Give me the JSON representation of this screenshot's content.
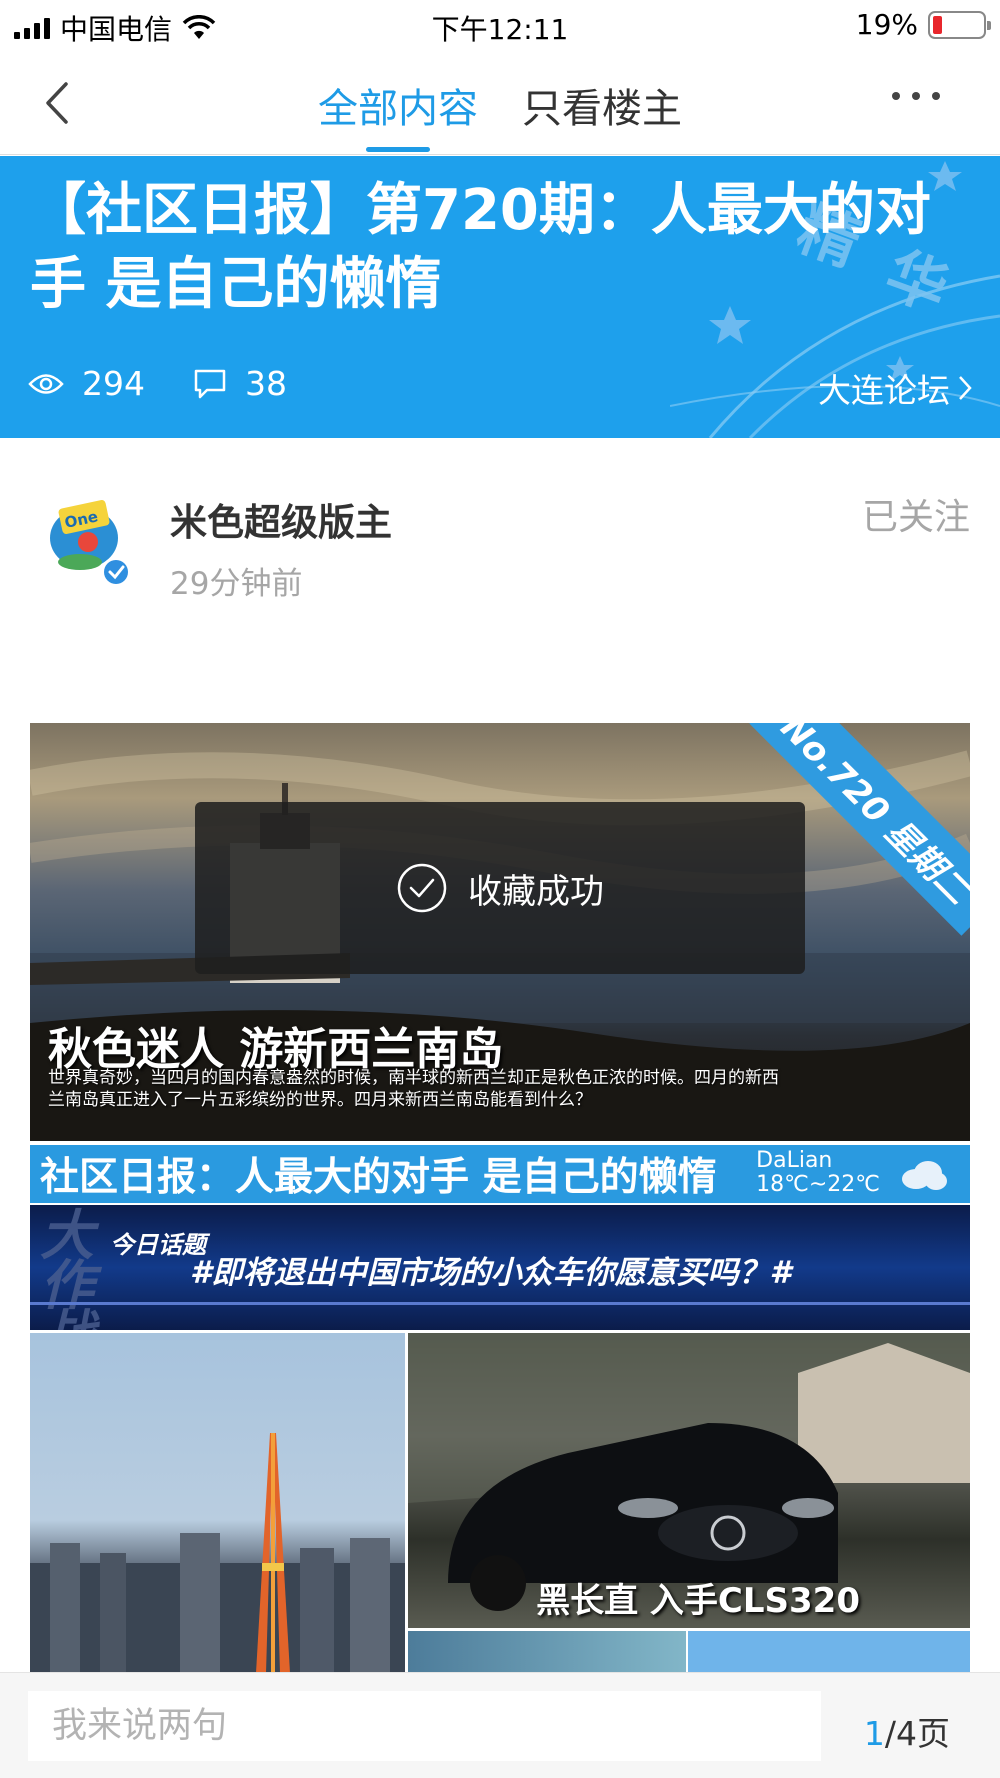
{
  "status_bar": {
    "carrier": "中国电信",
    "time": "下午12:11",
    "battery": "19%",
    "battery_level": 0.19,
    "low_battery_color": "#e8262c"
  },
  "nav": {
    "back_icon": "chevron-left-icon",
    "tabs": [
      {
        "label": "全部内容",
        "active": true
      },
      {
        "label": "只看楼主",
        "active": false
      }
    ],
    "more_icon": "more-dots-icon",
    "accent_color": "#1e9be6"
  },
  "banner": {
    "title": "【社区日报】第720期：人最大的对手 是自己的懒惰",
    "views": "294",
    "comments": "38",
    "forum_name": "大连论坛",
    "background_color": "#1ea0ec"
  },
  "author": {
    "name": "米色超级版主",
    "time_ago": "29分钟前",
    "follow_label": "已关注",
    "verified": true
  },
  "post_image": {
    "ribbon": "No.720 星期二",
    "headline": "秋色迷人 游新西兰南岛",
    "description": "世界真奇妙，当四月的国内春意盎然的时候，南半球的新西兰却正是秋色正浓的时候。四月的新西兰南岛真正进入了一片五彩缤纷的世界。四月来新西兰南岛能看到什么？",
    "banner_title": "社区日报：人最大的对手 是自己的懒惰",
    "weather_city": "DaLian",
    "weather_temp": "18℃~22℃",
    "topic_bg": "大\n作\n战",
    "topic_label": "今日话题",
    "topic_text": "#即将退出中国市场的小众车你愿意买吗？#",
    "car_caption": "黑长直 入手CLS320"
  },
  "toast": {
    "message": "收藏成功",
    "icon": "check-circle-icon"
  },
  "bottom": {
    "comment_placeholder": "我来说两句",
    "page_current": "1",
    "page_total": "/4页"
  }
}
